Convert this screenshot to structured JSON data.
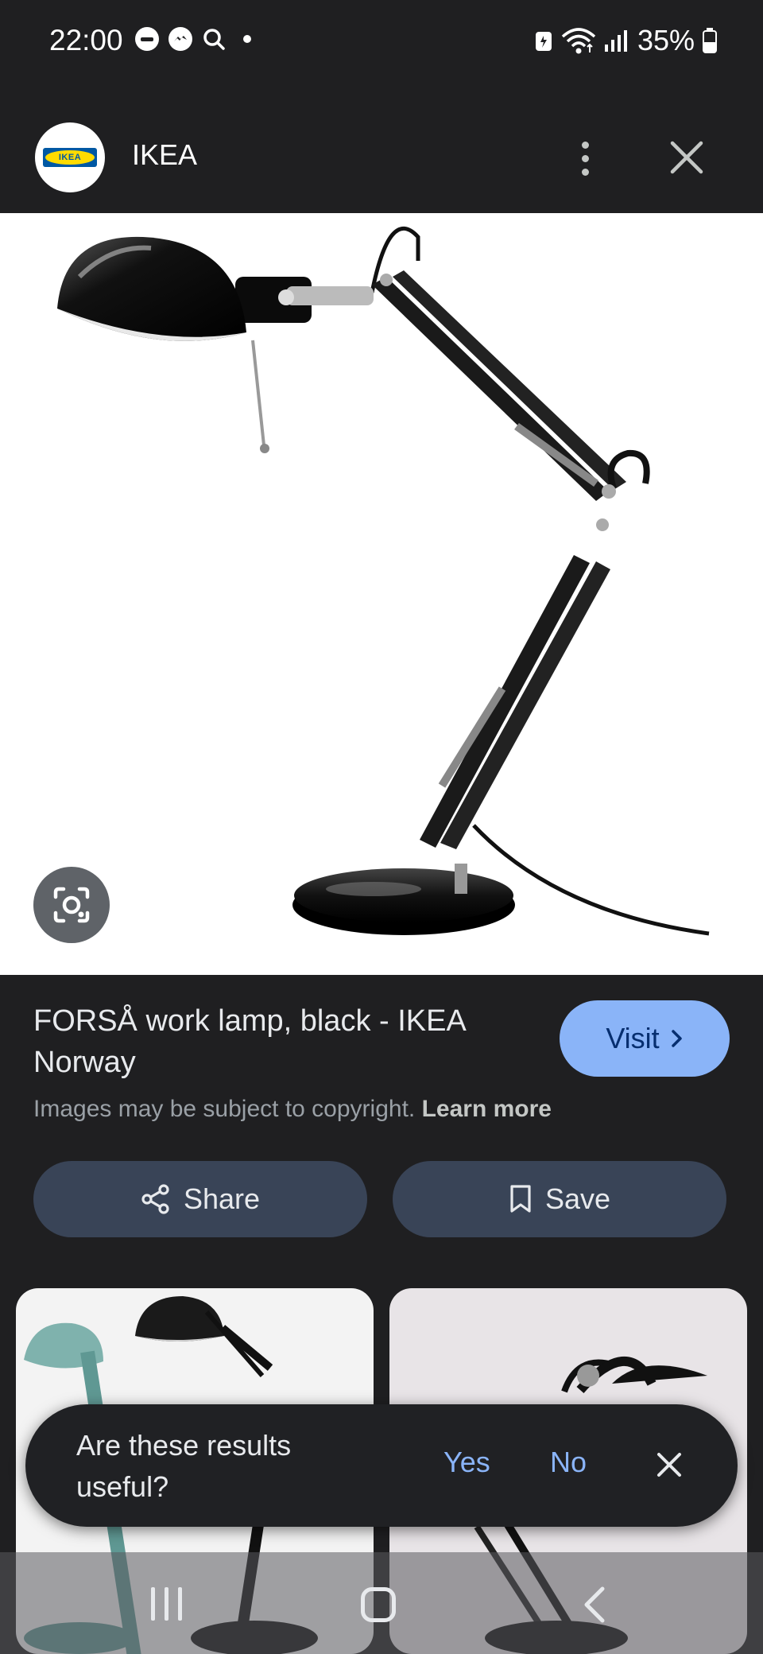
{
  "status_bar": {
    "time": "22:00",
    "battery": "35%",
    "icons": [
      "do-not-disturb-icon",
      "messenger-icon",
      "search-icon",
      "notification-dot",
      "battery-saver-icon",
      "wifi-icon",
      "signal-icon",
      "battery-icon"
    ]
  },
  "header": {
    "site_name": "IKEA",
    "logo_text": "IKEA"
  },
  "result": {
    "title": "FORSÅ work lamp, black - IKEA Norway",
    "visit_label": "Visit",
    "copyright_text": "Images may be subject to copyright.",
    "learn_more": "Learn more"
  },
  "actions": {
    "share_label": "Share",
    "save_label": "Save"
  },
  "feedback": {
    "question": "Are these results useful?",
    "yes_label": "Yes",
    "no_label": "No"
  },
  "colors": {
    "background": "#1f1f21",
    "accent": "#8ab4f8",
    "action_button": "#394457"
  }
}
